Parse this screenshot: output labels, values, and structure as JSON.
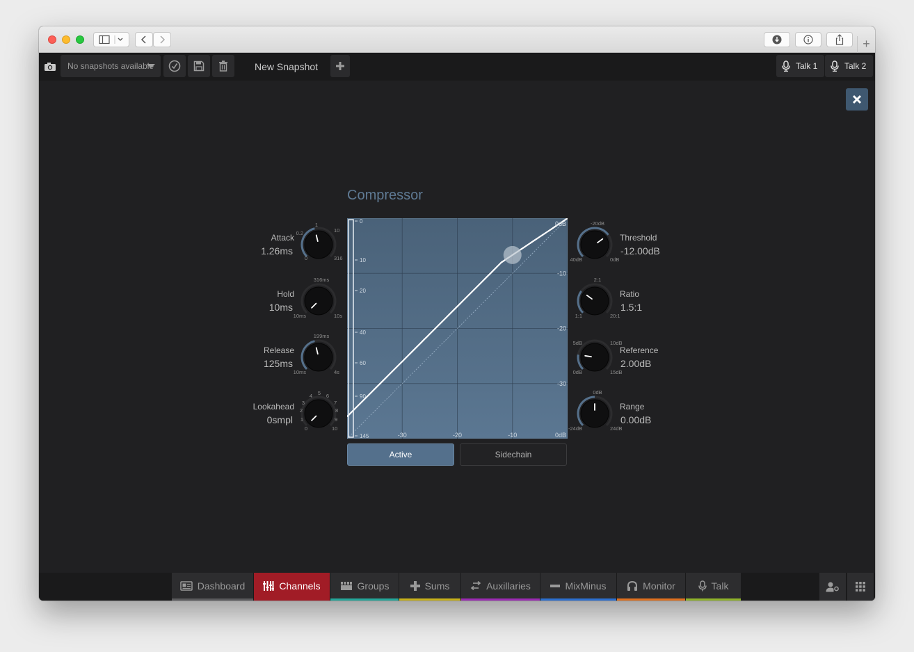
{
  "toolbar": {
    "snapshot_select": "No snapshots available",
    "new_snapshot": "New Snapshot",
    "talk1": "Talk 1",
    "talk2": "Talk 2"
  },
  "compressor": {
    "title": "Compressor",
    "left_knobs": [
      {
        "label": "Attack",
        "value": "1.26ms",
        "level": 0.45,
        "ticks": [
          "0.2",
          "1",
          "10",
          "0",
          "316"
        ]
      },
      {
        "label": "Hold",
        "value": "10ms",
        "level": 0.0,
        "ticks": [
          "316ms",
          "10ms",
          "10s"
        ]
      },
      {
        "label": "Release",
        "value": "125ms",
        "level": 0.45,
        "ticks": [
          "199ms",
          "10ms",
          "4s"
        ]
      },
      {
        "label": "Lookahead",
        "value": "0smpl",
        "level": 0.0,
        "ticks": [
          "0",
          "1",
          "2",
          "3",
          "4",
          "5",
          "6",
          "7",
          "8",
          "9",
          "10"
        ]
      }
    ],
    "right_knobs": [
      {
        "label": "Threshold",
        "value": "-12.00dB",
        "level": 0.7,
        "ticks": [
          "-20dB",
          "40dB",
          "0dB"
        ]
      },
      {
        "label": "Ratio",
        "value": "1.5:1",
        "level": 0.3,
        "ticks": [
          "2:1",
          "1:1",
          "20:1"
        ]
      },
      {
        "label": "Reference",
        "value": "2.00dB",
        "level": 0.2,
        "ticks": [
          "5dB",
          "10dB",
          "0dB",
          "15dB"
        ]
      },
      {
        "label": "Range",
        "value": "0.00dB",
        "level": 0.5,
        "ticks": [
          "0dB",
          "-24dB",
          "24dB"
        ]
      }
    ],
    "graph": {
      "meter_ticks": [
        "0",
        "10",
        "20",
        "40",
        "60",
        "90",
        "145"
      ],
      "x_ticks": [
        "-30",
        "-20",
        "-10",
        "0dB"
      ],
      "y_ticks": [
        "0dB",
        "-10",
        "-20",
        "-30"
      ],
      "x_range": [
        -40,
        0
      ],
      "y_range": [
        -40,
        0
      ],
      "threshold_db": -12,
      "ratio": 1.5
    },
    "active_label": "Active",
    "sidechain_label": "Sidechain"
  },
  "nav": {
    "tabs": [
      {
        "label": "Dashboard",
        "color": "#5a5a5c"
      },
      {
        "label": "Channels",
        "color": "#a11c26"
      },
      {
        "label": "Groups",
        "color": "#23a79a"
      },
      {
        "label": "Sums",
        "color": "#c9b21a"
      },
      {
        "label": "Auxillaries",
        "color": "#9b2ab3"
      },
      {
        "label": "MixMinus",
        "color": "#2b6fd0"
      },
      {
        "label": "Monitor",
        "color": "#e0701e"
      },
      {
        "label": "Talk",
        "color": "#8fb32a"
      }
    ]
  }
}
